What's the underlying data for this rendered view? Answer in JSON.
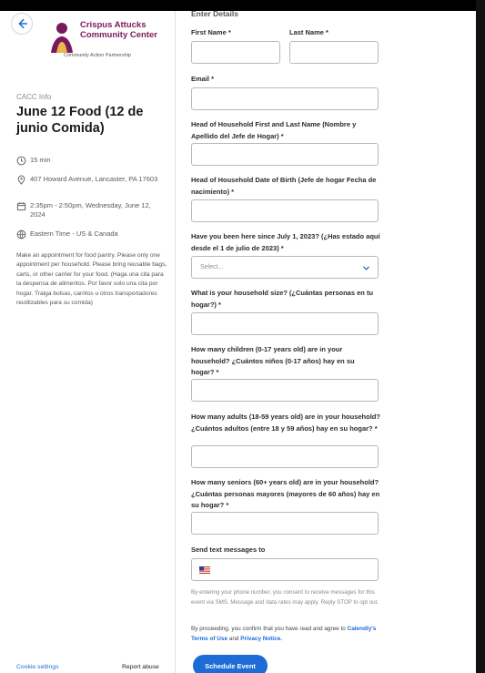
{
  "sidebar": {
    "logo": {
      "title_line1": "Crispus Attucks",
      "title_line2": "Community Center",
      "tagline": "Community Action Partnership"
    },
    "org_name": "CACC Info",
    "event_title": "June 12 Food (12 de junio Comida)",
    "duration": "15 min",
    "location": "407 Howard Avenue, Lancaster, PA 17603",
    "datetime": "2:35pm - 2:50pm, Wednesday, June 12, 2024",
    "timezone": "Eastern Time - US & Canada",
    "description": "Make an appointment for food pantry. Please only one appointment per household. Please bring reusable bags, carts, or other carrier for your food. (Haga una cita para la despensa de alimentos. Por favor solo una cita por hogar. Traiga bolsas, carritos u otros transportadores reutilizables para su comida)",
    "cookie_settings": "Cookie settings",
    "report_abuse": "Report abuse"
  },
  "form": {
    "section_heading": "Enter Details",
    "first_name_label": "First Name *",
    "last_name_label": "Last Name *",
    "email_label": "Email *",
    "hoh_name_label": "Head of Household First and Last Name (Nombre y Apellido del Jefe de Hogar) *",
    "hoh_dob_label": "Head of Household Date of Birth (Jefe de hogar Fecha de nacimiento) *",
    "been_here_label": "Have you been here since July 1, 2023? (¿Has estado aquí desde el 1 de julio de 2023) *",
    "been_here_placeholder": "Select...",
    "household_size_label": "What is your household size? (¿Cuántas personas en tu hogar?) *",
    "children_label": "How many children (0-17 years old) are in your household? ¿Cuántos niños (0-17 años) hay en su hogar? *",
    "adults_label": "How many adults (18-59 years old) are in your household? ¿Cuántos adultos (entre 18 y 59 años) hay en su hogar? *",
    "seniors_label": "How many seniors (60+ years old) are in your household? ¿Cuántas personas mayores (mayores de 60 años) hay en su hogar? *",
    "sms_label": "Send text messages to",
    "sms_note": "By entering your phone number, you consent to receive messages for this event via SMS. Message and data rates may apply. Reply STOP to opt out.",
    "terms_prefix": "By proceeding, you confirm that you have read and agree to",
    "terms_link": "Calendly's Terms of Use",
    "terms_and": "and",
    "privacy_link": "Privacy Notice.",
    "submit_label": "Schedule Event"
  },
  "colors": {
    "accent": "#1c6bd6",
    "brand": "#7a1a5c"
  }
}
